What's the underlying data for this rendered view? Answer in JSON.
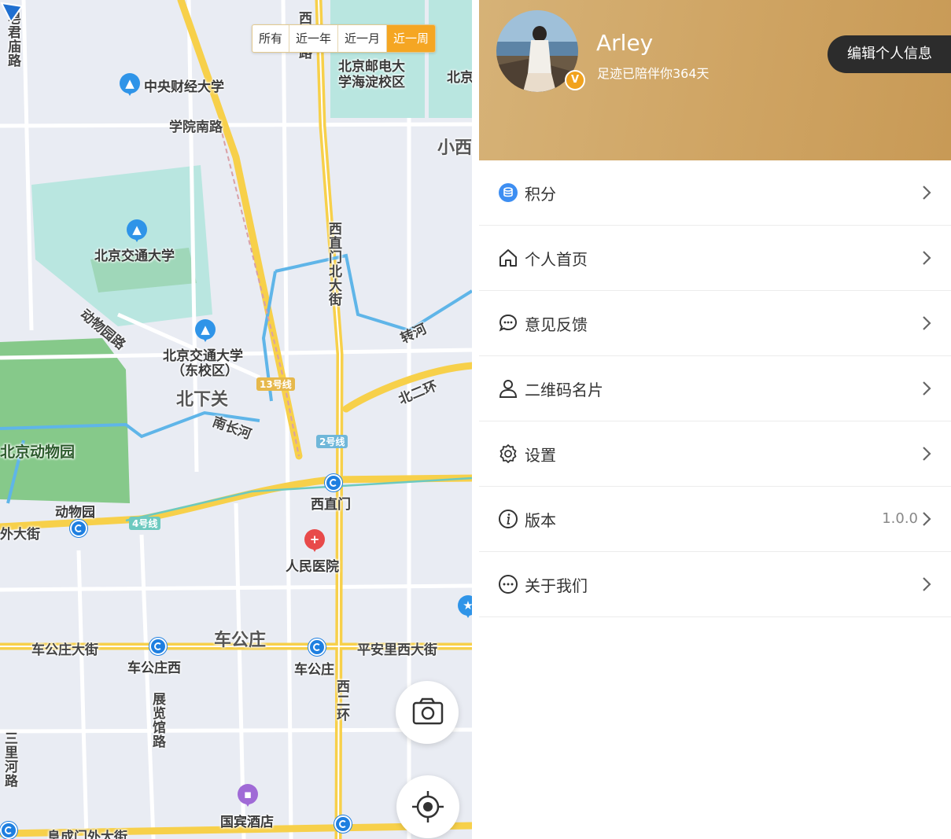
{
  "map": {
    "filter": [
      "所有",
      "近一年",
      "近一月",
      "近一周"
    ],
    "labels": {
      "zhongyang": "中央财经大学",
      "xueyuan_nanlu": "学院南路",
      "bjtu": "北京交通大学",
      "bjtu_east_1": "北京交通大学",
      "bjtu_east_2": "（东校区）",
      "dongwuyuan_lu": "动物园路",
      "beixiaguan": "北下关",
      "nanchanghe": "南长河",
      "zoo": "北京动物园",
      "zoo_station": "动物园",
      "xizhimen": "西直门",
      "renmin": "人民医院",
      "chegongzhuang": "车公庄",
      "chegongzhuang_dajie": "车公庄大街",
      "chegongzhuang_xi": "车公庄西",
      "chegongzhuang_station": "车公庄",
      "pinganli": "平安里西大街",
      "zhanlanguan": "展览馆路",
      "xierhuan": "西二环",
      "guobin": "国宾酒店",
      "fuchengmen": "阜成门外大街",
      "beiyou_1": "北京邮电大",
      "beiyou_2": "学海淀校区",
      "bei_edge": "北京",
      "xiao_xi": "小西",
      "xizhimen_north": "西直门北大街",
      "zhuanhe": "转河",
      "beierhuan": "北二环",
      "waidajie": "外大街",
      "zaojunmiao": "皂君庙路",
      "xi_top": "西",
      "sheng_road": "城路",
      "san_li": "三里河路",
      "line13": "13号线",
      "line2": "2号线",
      "line4": "4号线"
    },
    "icons": {
      "camera": "camera-icon",
      "locate": "locate-icon"
    }
  },
  "profile": {
    "username": "Arley",
    "days_text": "足迹已陪伴你364天",
    "badge": "V",
    "edit_label": "编辑个人信息",
    "menu": [
      {
        "label": "积分",
        "icon": "coin-icon",
        "value": ""
      },
      {
        "label": "个人首页",
        "icon": "home-icon",
        "value": ""
      },
      {
        "label": "意见反馈",
        "icon": "chat-icon",
        "value": ""
      },
      {
        "label": "二维码名片",
        "icon": "user-icon",
        "value": ""
      },
      {
        "label": "设置",
        "icon": "gear-icon",
        "value": ""
      },
      {
        "label": "版本",
        "icon": "info-icon",
        "value": "1.0.0"
      },
      {
        "label": "关于我们",
        "icon": "more-icon",
        "value": ""
      }
    ],
    "colors": {
      "header": "#cfa463",
      "edit_button": "#2c2c2c",
      "active_filter": "#f5a623"
    }
  }
}
